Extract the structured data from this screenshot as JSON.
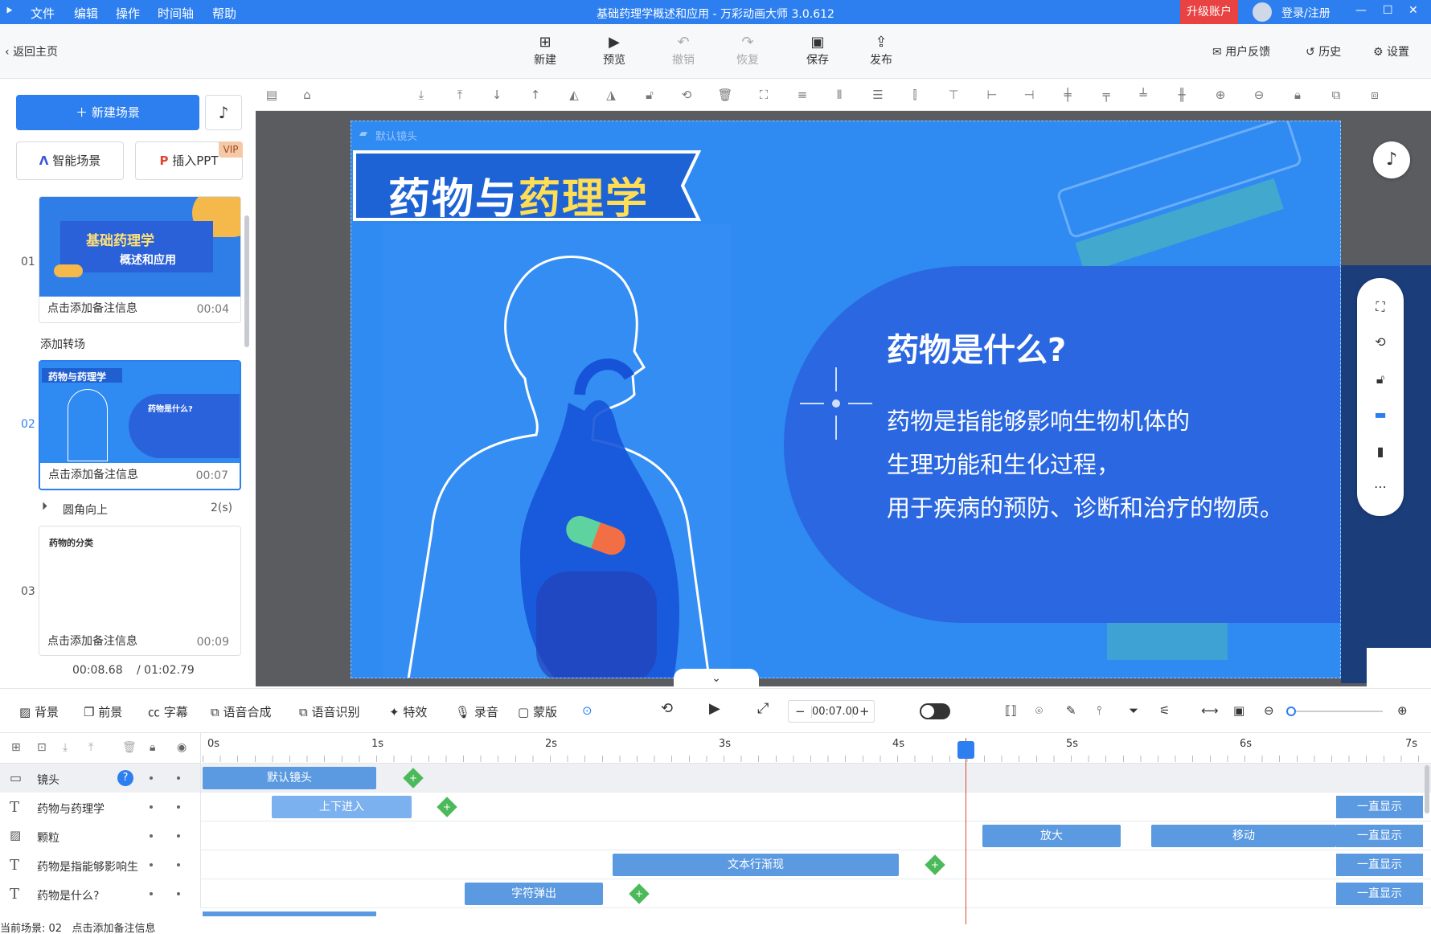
{
  "titlebar": {
    "menus": [
      "文件",
      "编辑",
      "操作",
      "时间轴",
      "帮助"
    ],
    "title": "基础药理学概述和应用 - 万彩动画大师 3.0.612",
    "upgrade": "升级账户",
    "login": "登录/注册",
    "win_min": "—",
    "win_max": "☐",
    "win_close": "✕",
    "accent": "#2d7ff0"
  },
  "toolbar": {
    "back": "返回主页",
    "buttons": [
      {
        "label": "新建",
        "icon": "new-icon"
      },
      {
        "label": "预览",
        "icon": "play-icon"
      },
      {
        "label": "撤销",
        "icon": "undo-icon"
      },
      {
        "label": "恢复",
        "icon": "redo-icon"
      },
      {
        "label": "保存",
        "icon": "save-icon"
      },
      {
        "label": "发布",
        "icon": "publish-icon"
      }
    ],
    "feedback": "用户反馈",
    "history": "历史",
    "settings": "设置"
  },
  "left": {
    "new_scene": "新建场景",
    "smart_scene": "智能场景",
    "insert_ppt": "插入PPT",
    "vip": "VIP",
    "scenes": [
      {
        "num": "01",
        "caption": "点击添加备注信息",
        "duration": "00:04",
        "thumb_title": "基础药理学",
        "thumb_sub": "概述和应用"
      },
      {
        "num": "02",
        "caption": "点击添加备注信息",
        "duration": "00:07",
        "thumb_title": "药物与药理学",
        "thumb_sub": "药物是什么?"
      },
      {
        "num": "03",
        "caption": "点击添加备注信息",
        "duration": "00:09",
        "thumb_title": "药物的分类"
      }
    ],
    "add_transition": "添加转场",
    "transition": {
      "name": "圆角向上",
      "dur": "2(s)"
    },
    "time_current": "00:08.68",
    "time_total": "/ 01:02.79"
  },
  "slide": {
    "camera_label": "默认镜头",
    "title_white": "药物与",
    "title_yellow": "药理学",
    "heading": "药物是什么?",
    "lines": [
      "药物是指能够影响生物机体的",
      "生理功能和生化过程，",
      "用于疾病的预防、诊断和治疗的物质。"
    ],
    "bg_color": "#2f8af2"
  },
  "funcbar": {
    "items": [
      "背景",
      "前景",
      "字幕",
      "语音合成",
      "语音识别",
      "特效",
      "录音",
      "蒙版"
    ],
    "time_value": "00:07.00"
  },
  "timeline": {
    "ticks": [
      "0s",
      "1s",
      "2s",
      "3s",
      "4s",
      "5s",
      "6s",
      "7s"
    ],
    "rows": [
      {
        "name": "镜头",
        "icon": "camera-icon"
      },
      {
        "name": "药物与药理学",
        "icon": "text-icon"
      },
      {
        "name": "颗粒",
        "icon": "image-icon"
      },
      {
        "name": "药物是指能够影响生",
        "icon": "text-icon"
      },
      {
        "name": "药物是什么?",
        "icon": "text-icon"
      }
    ],
    "clips": {
      "camera": "默认镜头",
      "title": "上下进入",
      "particle1": "放大",
      "particle2": "移动",
      "body": "文本行渐现",
      "heading": "字符弹出"
    },
    "always": "一直显示",
    "help": "?",
    "footer": "当前场景: 02   点击添加备注信息"
  }
}
